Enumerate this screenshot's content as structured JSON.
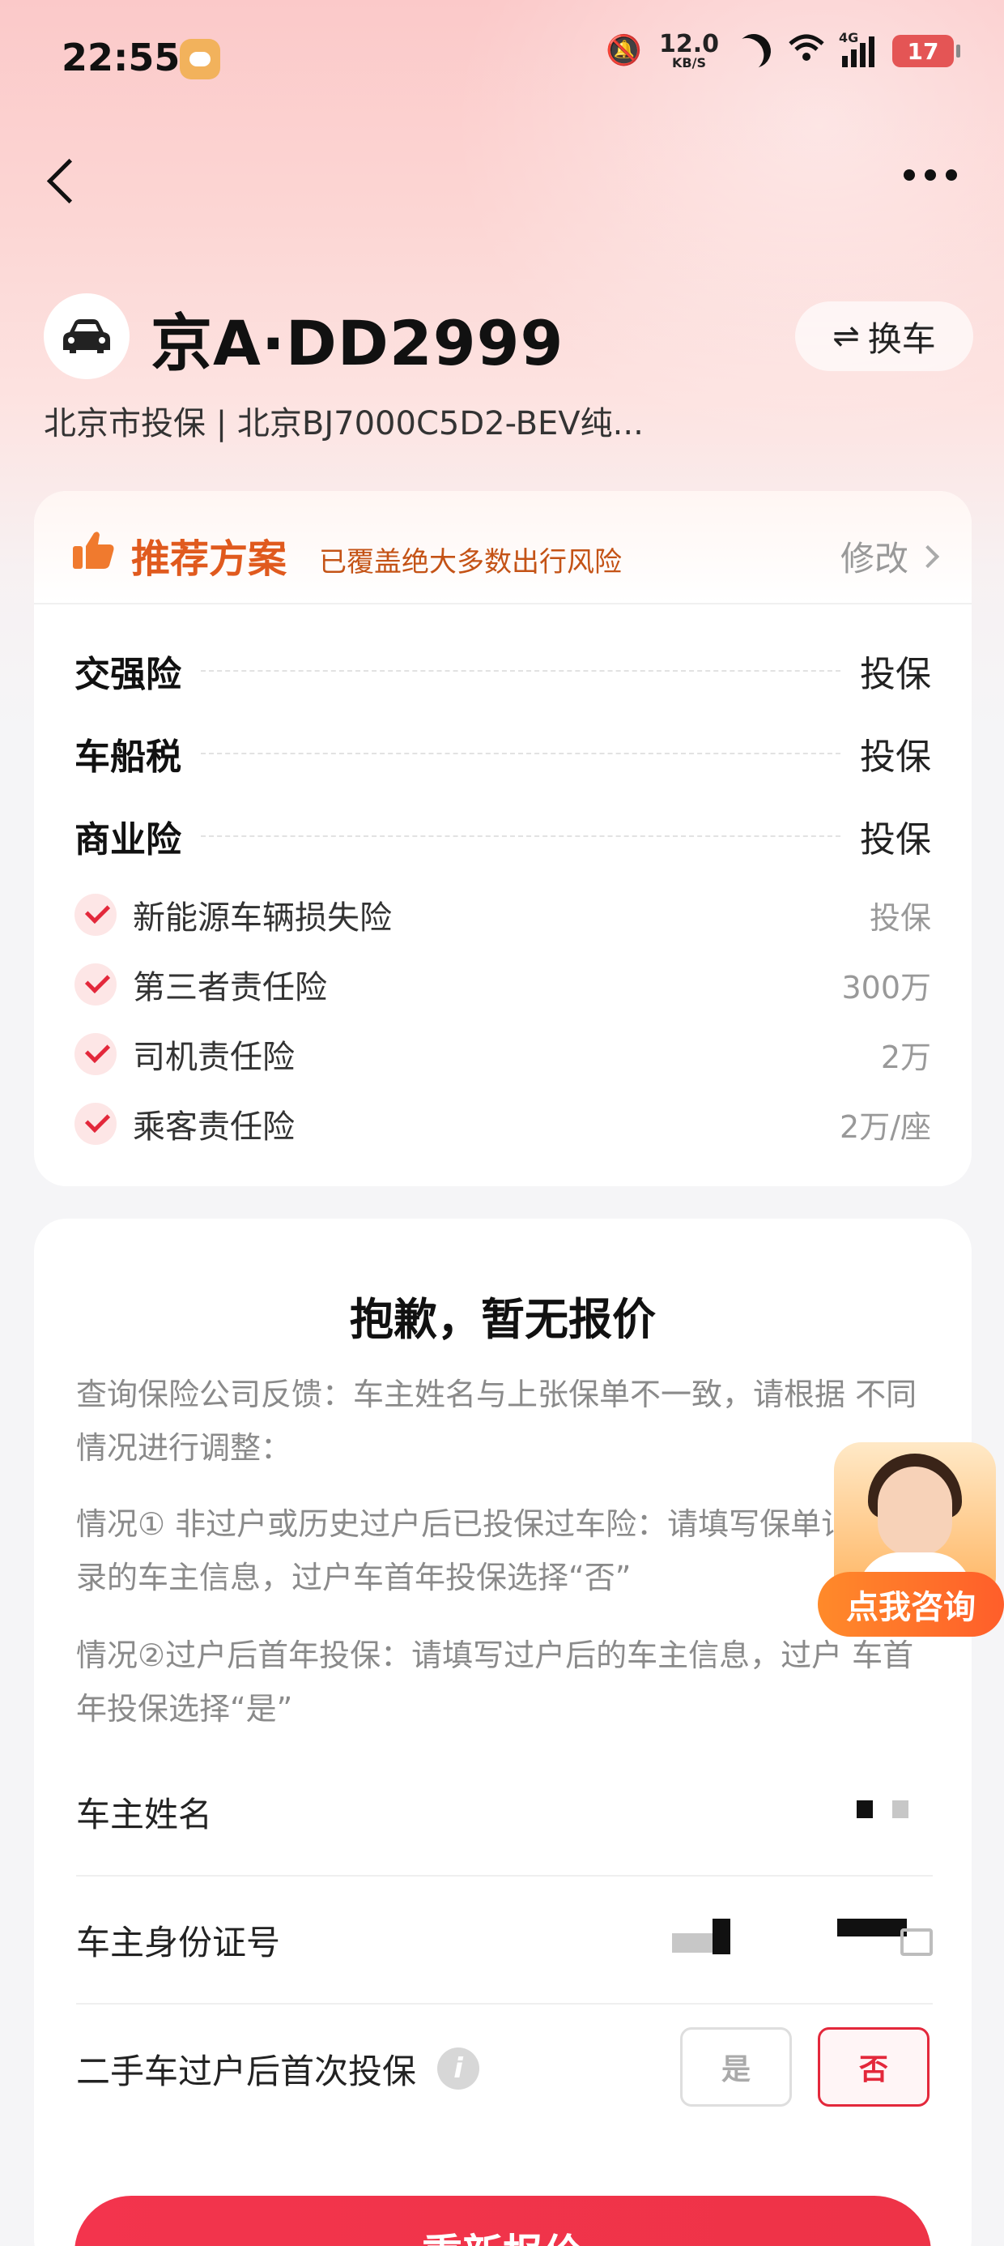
{
  "status_bar": {
    "time": "22:55",
    "net_speed_value": "12.0",
    "net_speed_unit": "KB/S",
    "network_type": "4G",
    "battery": "17"
  },
  "vehicle": {
    "plate": "京A·DD2999",
    "subtitle": "北京市投保 | 北京BJ7000C5D2-BEV纯...",
    "switch_label": "换车"
  },
  "plan": {
    "title": "推荐方案",
    "description": "已覆盖绝大多数出行风险",
    "edit_label": "修改",
    "main_items": [
      {
        "name": "交强险",
        "value": "投保"
      },
      {
        "name": "车船税",
        "value": "投保"
      },
      {
        "name": "商业险",
        "value": "投保"
      }
    ],
    "sub_items": [
      {
        "name": "新能源车辆损失险",
        "value": "投保"
      },
      {
        "name": "第三者责任险",
        "value": "300万"
      },
      {
        "name": "司机责任险",
        "value": "2万"
      },
      {
        "name": "乘客责任险",
        "value": "2万/座"
      }
    ]
  },
  "quote": {
    "title": "抱歉，暂无报价",
    "reason": "查询保险公司反馈：车主姓名与上张保单不一致，请根据 不同情况进行调整：",
    "case1": "情况① 非过户或历史过户后已投保过车险：请填写保单记录的车主信息，过户车首年投保选择“否”",
    "case2": "情况②过户后首年投保：请填写过户后的车主信息，过户 车首年投保选择“是”",
    "owner_name_label": "车主姓名",
    "owner_id_label": "车主身份证号",
    "transfer_label": "二手车过户后首次投保",
    "yes_label": "是",
    "no_label": "否",
    "requote_label": "重新报价"
  },
  "consult": {
    "label": "点我咨询"
  },
  "colors": {
    "brand_red": "#e3283b",
    "plan_orange": "#e05a1e",
    "consult_orange": "#ff7a2a"
  }
}
